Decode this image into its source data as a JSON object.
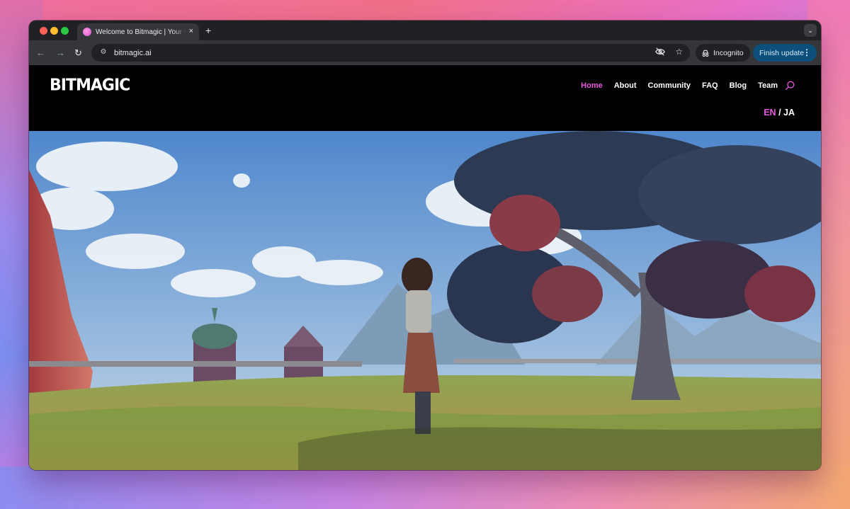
{
  "browser": {
    "tab_title": "Welcome to Bitmagic | Your G",
    "tab_close": "×",
    "new_tab": "+",
    "tab_menu": "⌄",
    "url": "bitmagic.ai",
    "incognito_label": "Incognito",
    "finish_update_label": "Finish update",
    "icons": [
      "back-icon",
      "forward-icon",
      "reload-icon",
      "site-info-icon",
      "eye-off-icon",
      "star-icon",
      "incognito-icon",
      "more-icon"
    ]
  },
  "site": {
    "logo": "BITMAGIC",
    "nav": [
      {
        "label": "Home",
        "active": true
      },
      {
        "label": "About",
        "active": false
      },
      {
        "label": "Community",
        "active": false
      },
      {
        "label": "FAQ",
        "active": false
      },
      {
        "label": "Blog",
        "active": false
      },
      {
        "label": "Team",
        "active": false
      }
    ],
    "lang_en": "EN",
    "lang_sep": " / ",
    "lang_ja": "JA",
    "accent_color": "#e75ae0"
  }
}
